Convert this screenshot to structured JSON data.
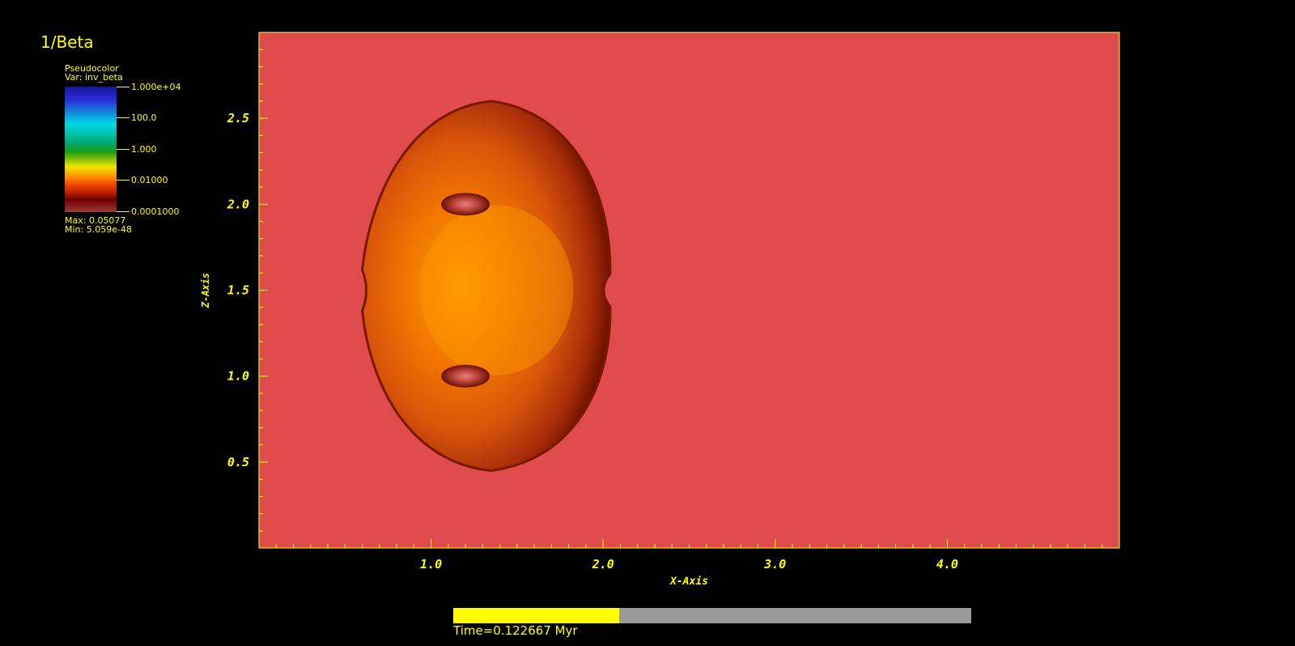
{
  "title": "1/Beta",
  "legend": {
    "plot_type": "Pseudocolor",
    "var_label": "Var: inv_beta",
    "tick_labels": [
      "1.000e+04",
      "100.0",
      "1.000",
      "0.01000",
      "0.0001000"
    ],
    "max_label": "Max:  0.05077",
    "min_label": "Min:  5.059e-48"
  },
  "time": {
    "label": "Time=0.122667 Myr",
    "progress": 0.32
  },
  "colors": {
    "text": "#ffff00",
    "background_field": "#e04c4c",
    "bubble_center": "#ff9800",
    "bubble_edge": "#7a1800"
  },
  "chart_data": {
    "type": "heatmap",
    "variable": "inv_beta",
    "xlabel": "X-Axis",
    "ylabel": "Z-Axis",
    "xlim": [
      0,
      5.0
    ],
    "ylim": [
      0,
      3.0
    ],
    "xticks": [
      1.0,
      2.0,
      3.0,
      4.0
    ],
    "xtick_labels": [
      "1.0",
      "2.0",
      "3.0",
      "4.0"
    ],
    "yticks": [
      0.5,
      1.0,
      1.5,
      2.0,
      2.5
    ],
    "ytick_labels": [
      "0.5",
      "1.0",
      "1.5",
      "2.0",
      "2.5"
    ],
    "color_scale": "log",
    "color_range": [
      0.0001,
      10000
    ],
    "data_max": 0.05077,
    "data_min": 5.059e-48,
    "features": {
      "bubble_center": [
        1.35,
        1.5
      ],
      "bubble_x_extent": [
        0.6,
        2.05
      ],
      "bubble_z_extent": [
        0.45,
        2.6
      ],
      "vortex_centers": [
        [
          1.2,
          2.0
        ],
        [
          1.2,
          1.0
        ]
      ]
    }
  }
}
